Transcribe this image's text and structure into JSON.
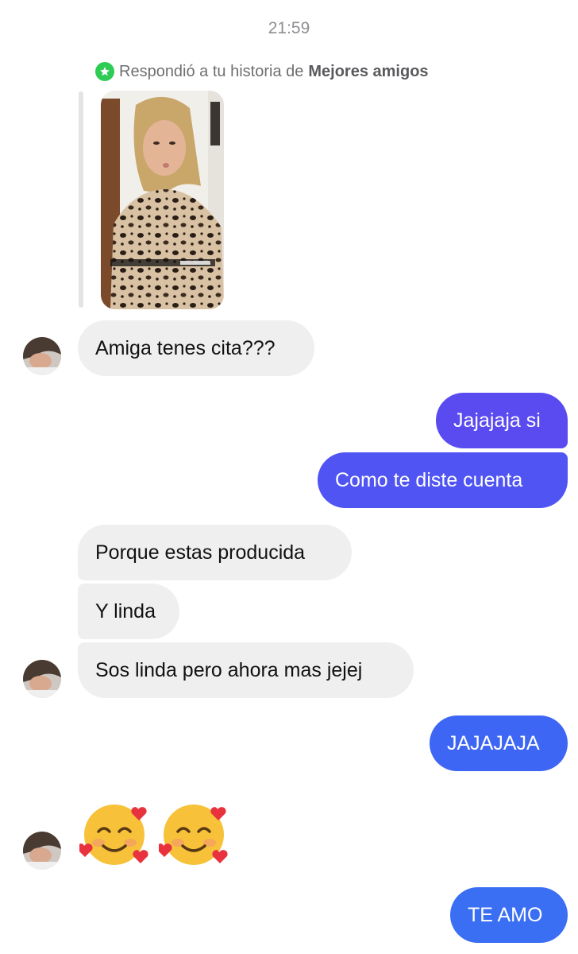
{
  "timestamp": "21:59",
  "story_reply": {
    "prefix": "Respondió a tu historia de",
    "list_name": "Mejores amigos",
    "badge_color": "#2ecc55",
    "badge_icon": "star-icon"
  },
  "messages": [
    {
      "side": "in",
      "text": "Amiga tenes cita???"
    },
    {
      "side": "out",
      "text": "Jajajaja si",
      "color": "#5a4bf0"
    },
    {
      "side": "out",
      "text": "Como te diste cuenta",
      "color": "#4f54f2"
    },
    {
      "side": "in",
      "text": "Porque estas producida"
    },
    {
      "side": "in",
      "text": "Y linda"
    },
    {
      "side": "in",
      "text": "Sos linda pero ahora mas jejej"
    },
    {
      "side": "out",
      "text": "JAJAJAJA",
      "color": "#3d66f4"
    },
    {
      "side": "in",
      "emoji": "smiling-face-with-hearts",
      "count": 2
    },
    {
      "side": "out",
      "text": "TE AMO",
      "color": "#3a6ff4"
    }
  ],
  "colors": {
    "incoming_bubble": "#efefef",
    "timestamp": "#8e8e93"
  }
}
